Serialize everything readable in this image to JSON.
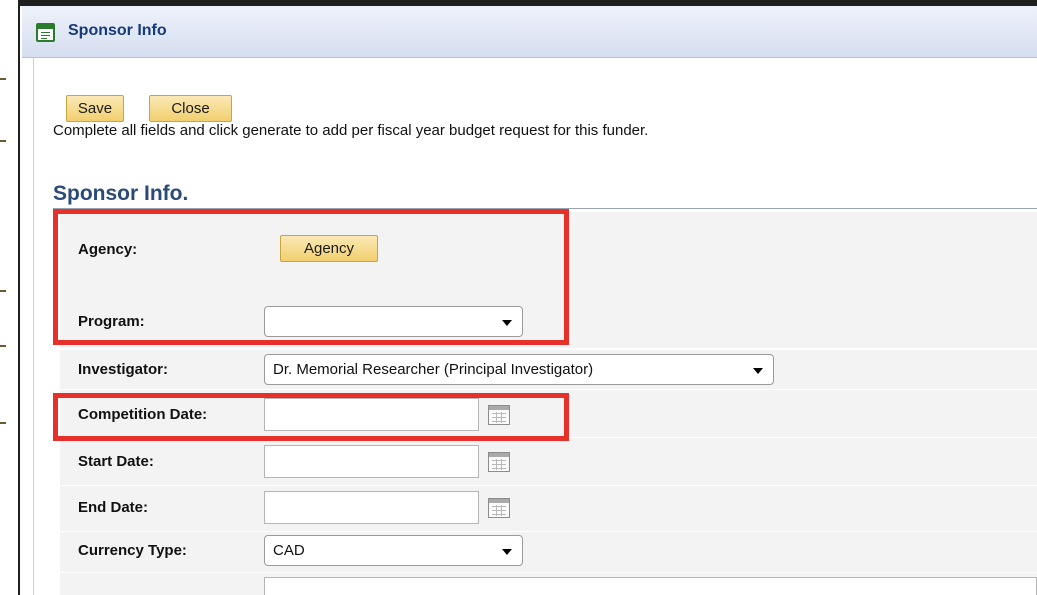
{
  "dialog": {
    "title": "Sponsor Info",
    "title_icon": "form-icon"
  },
  "toolbar": {
    "save_label": "Save",
    "close_label": "Close"
  },
  "instructions": "Complete all fields and click generate to add per fiscal year budget request for this funder.",
  "section": {
    "title": "Sponsor Info."
  },
  "form": {
    "agency": {
      "label": "Agency:",
      "button_label": "Agency"
    },
    "program": {
      "label": "Program:",
      "value": ""
    },
    "investigator": {
      "label": "Investigator:",
      "value": "Dr. Memorial Researcher (Principal Investigator)"
    },
    "competition_date": {
      "label": "Competition Date:",
      "value": ""
    },
    "start_date": {
      "label": "Start Date:",
      "value": ""
    },
    "end_date": {
      "label": "End Date:",
      "value": ""
    },
    "currency_type": {
      "label": "Currency Type:",
      "value": "CAD"
    }
  },
  "colors": {
    "title_text": "#173a7a",
    "section_title": "#2b4a7a",
    "button_gold": "#f2cf6f",
    "highlight_red": "#e8302a",
    "row_background": "#f3f3f3"
  }
}
